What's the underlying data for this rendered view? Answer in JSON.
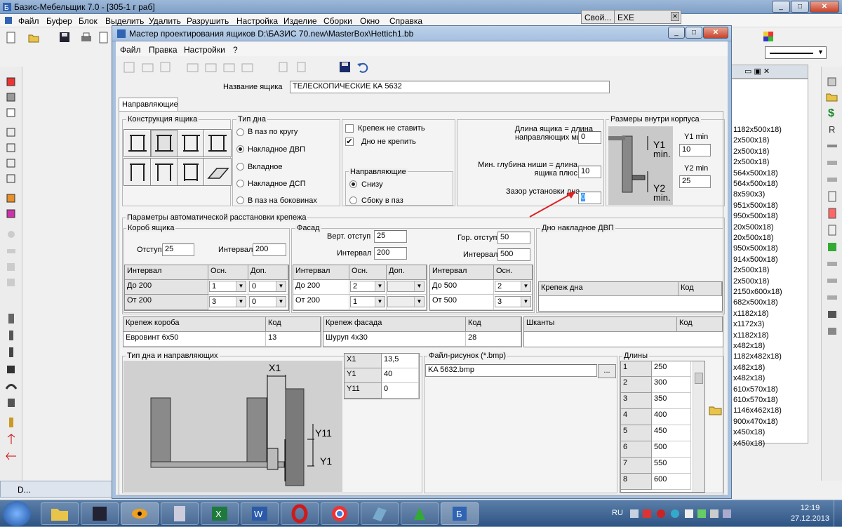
{
  "app": {
    "title": "Базис-Мебельщик 7.0 - [305-1 г раб]",
    "menu": [
      "Файл",
      "Буфер",
      "Блок",
      "Выделить",
      "Удалить",
      "Разрушить",
      "Настройка",
      "Изделие",
      "Сборки",
      "Окно",
      "Справка"
    ],
    "bg_button_1": "Свой...",
    "bg_button_2": "EXE",
    "status_label": "D...",
    "bg_list": [
      "1182x500x18)",
      "2x500x18)",
      "2x500x18)",
      "2x500x18)",
      "564x500x18)",
      "564x500x18)",
      "8x590x3)",
      "951x500x18)",
      "950x500x18)",
      "20x500x18)",
      "20x500x18)",
      "950x500x18)",
      "914x500x18)",
      "2x500x18)",
      "2x500x18)",
      "2150x600x18)",
      "682x500x18)",
      "x1182x18)",
      "x1172x3)",
      "x1182x18)",
      "x482x18)",
      "1182x482x18)",
      "x482x18)",
      "x482x18)",
      "610x570x18)",
      "610x570x18)",
      "1146x462x18)",
      "900x470x18)",
      "x450x18)",
      "x450x18)"
    ]
  },
  "dialog": {
    "title": "Мастер проектирования ящиков  D:\\БАЗИС 70.new\\MasterBox\\Hettich1.bb",
    "menu": [
      "Файл",
      "Правка",
      "Настройки",
      "?"
    ],
    "name_label": "Название ящика",
    "name_value": "ТЕЛЕСКОПИЧЕСКИЕ КА 5632",
    "tab": "Направляющие",
    "construction_title": "Конструкция ящика",
    "bottom_type": {
      "title": "Тип дна",
      "options": [
        "В паз по кругу",
        "Накладное ДВП",
        "Вкладное",
        "Накладное ДСП",
        "В паз на боковинах"
      ],
      "selected": "Накладное ДВП"
    },
    "checks": {
      "no_fastener": "Крепеж не ставить",
      "no_fastener_checked": "false",
      "bottom_no_fix": "Дно не крепить",
      "bottom_no_fix_checked": "true"
    },
    "guides": {
      "title": "Направляющие",
      "options": [
        "Снизу",
        "Сбоку в паз"
      ],
      "selected": "Снизу"
    },
    "lengths": {
      "len_label": "Длина ящика = длина направляющих минус",
      "len_value": "0",
      "depth_label": "Мин. глубина ниши = длина ящика плюс",
      "depth_value": "10",
      "gap_label": "Зазор установки дна",
      "gap_value": "0"
    },
    "inner_sizes": {
      "title": "Размеры внутри корпуса",
      "y1_label": "Y1 min",
      "y1_value": "10",
      "y2_label": "Y2 min",
      "y2_value": "25",
      "pic_y1": "Y1",
      "pic_y1_min": "min.",
      "pic_y2": "Y2",
      "pic_y2_min": "min."
    },
    "auto_params_title": "Параметры автоматической расстановки крепежа",
    "box": {
      "title": "Короб ящика",
      "offset_label": "Отступ",
      "offset_value": "25",
      "interval_label": "Интервал",
      "interval_value": "200",
      "headers": [
        "Интервал",
        "Осн.",
        "Доп."
      ],
      "rows": [
        {
          "interval": "До 200",
          "main": "1",
          "extra": "0"
        },
        {
          "interval": "От 200",
          "main": "3",
          "extra": "0"
        }
      ]
    },
    "facade": {
      "title": "Фасад",
      "vert_offset_label": "Верт. отступ",
      "vert_offset_value": "25",
      "vert_interval_label": "Интервал",
      "vert_interval_value": "200",
      "hor_offset_label": "Гор. отступ",
      "hor_offset_value": "50",
      "hor_interval_label": "Интервал",
      "hor_interval_value": "500",
      "v_headers": [
        "Интервал",
        "Осн.",
        "Доп."
      ],
      "v_rows": [
        {
          "interval": "До 200",
          "main": "2",
          "extra": ""
        },
        {
          "interval": "От 200",
          "main": "1",
          "extra": ""
        }
      ],
      "h_headers": [
        "Интервал",
        "Осн."
      ],
      "h_rows": [
        {
          "interval": "До 500",
          "main": "2"
        },
        {
          "interval": "От 500",
          "main": "3"
        }
      ]
    },
    "dvp": {
      "title": "Дно накладное ДВП",
      "headers": [
        "Крепеж дна",
        "Код"
      ]
    },
    "fasteners": {
      "box_headers": [
        "Крепеж короба",
        "Код"
      ],
      "box_row": [
        "Евровинт 6x50",
        "13"
      ],
      "facade_headers": [
        "Крепеж фасада",
        "Код"
      ],
      "facade_row": [
        "Шуруп 4x30",
        "28"
      ],
      "dowel_headers": [
        "Шканты",
        "Код"
      ]
    },
    "drawing": {
      "title": "Тип дна и направляющих",
      "x1": "X1",
      "y11": "Y11",
      "y1": "Y1"
    },
    "params": [
      {
        "k": "X1",
        "v": "13,5"
      },
      {
        "k": "Y1",
        "v": "40"
      },
      {
        "k": "Y11",
        "v": "0"
      }
    ],
    "picture": {
      "title": "Файл-рисунок (*.bmp)",
      "value": "KA 5632.bmp",
      "browse": "..."
    },
    "lengths_list": {
      "title": "Длины",
      "rows": [
        {
          "n": "1",
          "v": "250"
        },
        {
          "n": "2",
          "v": "300"
        },
        {
          "n": "3",
          "v": "350"
        },
        {
          "n": "4",
          "v": "400"
        },
        {
          "n": "5",
          "v": "450"
        },
        {
          "n": "6",
          "v": "500"
        },
        {
          "n": "7",
          "v": "550"
        },
        {
          "n": "8",
          "v": "600"
        }
      ]
    }
  },
  "taskbar": {
    "lang": "RU",
    "time": "12:19",
    "date": "27.12.2013"
  }
}
